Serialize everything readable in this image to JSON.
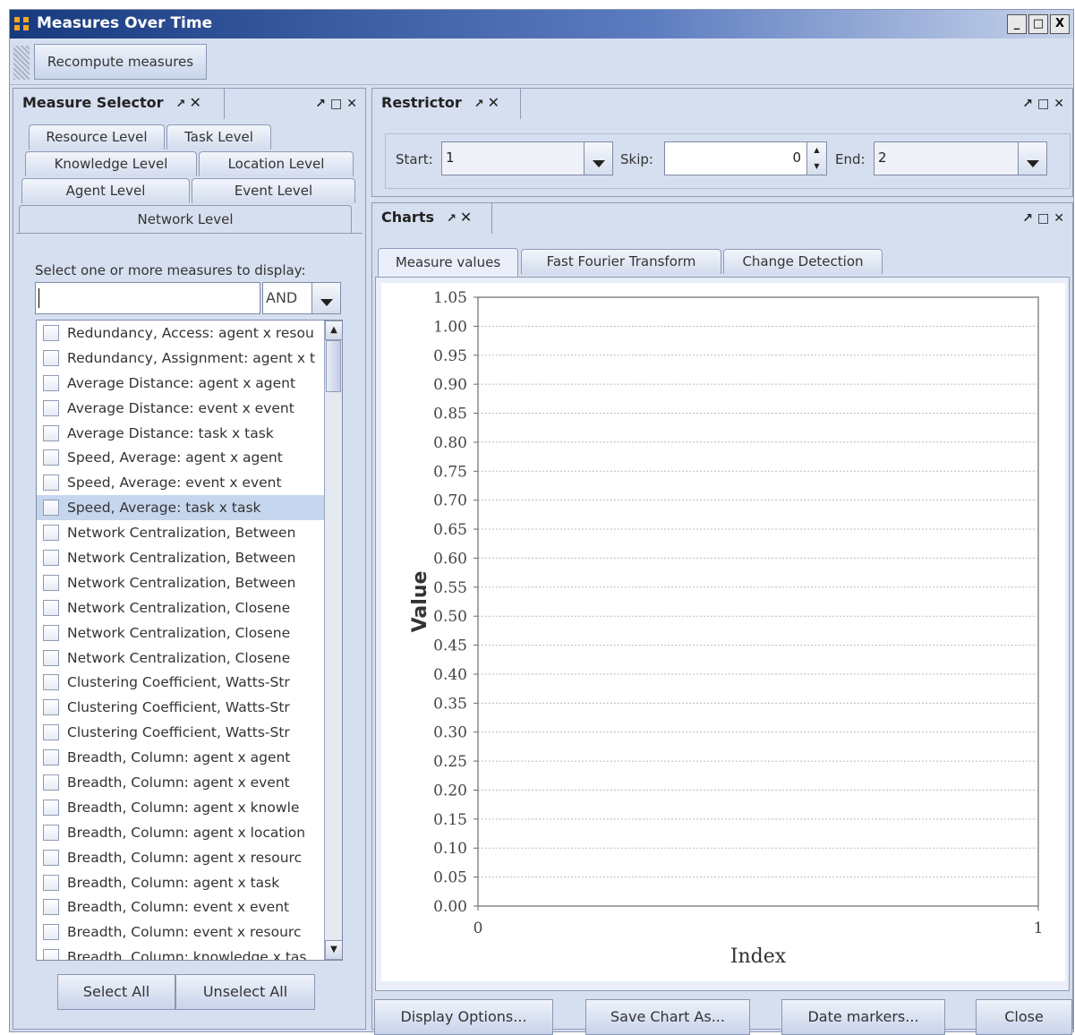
{
  "window": {
    "title": "Measures Over Time",
    "controls": [
      "_",
      "□",
      "X"
    ]
  },
  "toolbar": {
    "recompute": "Recompute measures"
  },
  "measure_selector": {
    "title": "Measure Selector",
    "tabs_row1": [
      "Resource Level",
      "Task Level"
    ],
    "tabs_row2": [
      "Knowledge Level",
      "Location Level"
    ],
    "tabs_row3": [
      "Agent Level",
      "Event Level"
    ],
    "active_tab": "Network Level",
    "prompt": "Select one or more measures to display:",
    "search_value": "",
    "operator": "AND",
    "items": [
      "Redundancy, Access: agent x resou",
      "Redundancy, Assignment: agent x t",
      "Average Distance: agent x agent",
      "Average Distance: event x event",
      "Average Distance: task x task",
      "Speed, Average: agent x agent",
      "Speed, Average: event x event",
      "Speed, Average: task x task",
      "Network Centralization, Between",
      "Network Centralization, Between",
      "Network Centralization, Between",
      "Network Centralization, Closene",
      "Network Centralization, Closene",
      "Network Centralization, Closene",
      "Clustering Coefficient, Watts-Str",
      "Clustering Coefficient, Watts-Str",
      "Clustering Coefficient, Watts-Str",
      "Breadth, Column: agent x agent",
      "Breadth, Column: agent x event",
      "Breadth, Column: agent x knowle",
      "Breadth, Column: agent x location",
      "Breadth, Column: agent x resourc",
      "Breadth, Column: agent x task",
      "Breadth, Column: event x event",
      "Breadth, Column: event x resourc",
      "Breadth, Column: knowledge x tas"
    ],
    "selected_index": 7,
    "select_all": "Select All",
    "unselect_all": "Unselect All"
  },
  "restrictor": {
    "title": "Restrictor",
    "start_label": "Start:",
    "start_value": "1",
    "skip_label": "Skip:",
    "skip_value": "0",
    "end_label": "End:",
    "end_value": "2"
  },
  "charts": {
    "title": "Charts",
    "tabs": [
      "Measure values",
      "Fast Fourier Transform",
      "Change Detection"
    ],
    "buttons": {
      "display": "Display Options...",
      "save": "Save Chart As...",
      "date": "Date markers...",
      "close": "Close"
    }
  },
  "chart_data": {
    "type": "line",
    "xlabel": "Index",
    "ylabel": "Value",
    "xlim": [
      0,
      1
    ],
    "ylim": [
      0,
      1.05
    ],
    "x_ticks": [
      "0",
      "1"
    ],
    "y_ticks": [
      "0.00",
      "0.05",
      "0.10",
      "0.15",
      "0.20",
      "0.25",
      "0.30",
      "0.35",
      "0.40",
      "0.45",
      "0.50",
      "0.55",
      "0.60",
      "0.65",
      "0.70",
      "0.75",
      "0.80",
      "0.85",
      "0.90",
      "0.95",
      "1.00",
      "1.05"
    ],
    "series": [],
    "grid": true
  }
}
